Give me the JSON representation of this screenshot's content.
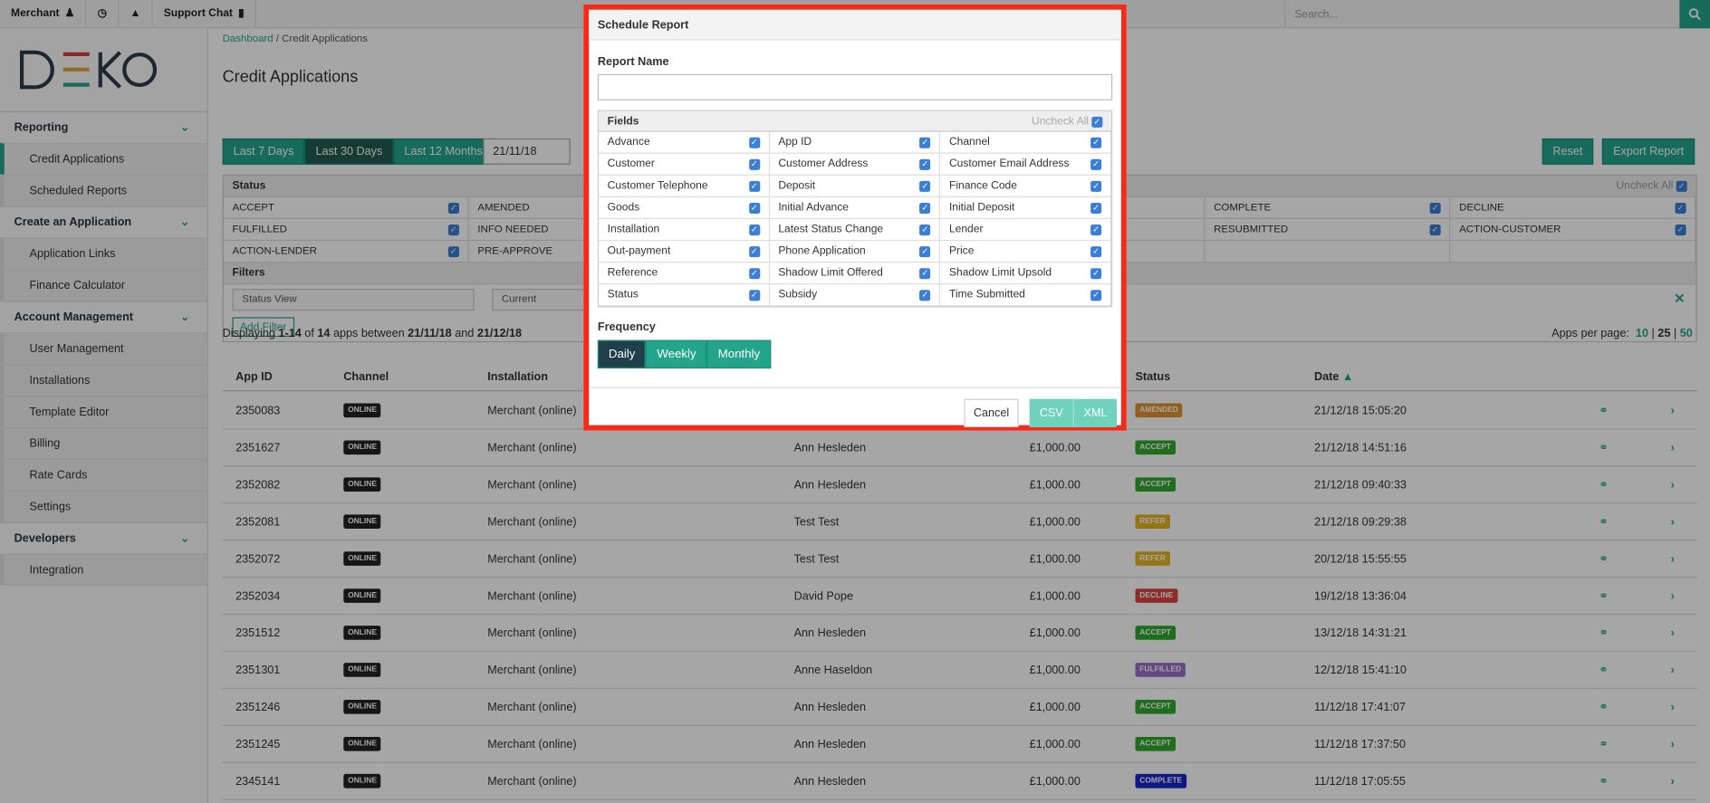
{
  "topbar": {
    "merchant": "Merchant",
    "support": "Support Chat",
    "search_placeholder": "Search..."
  },
  "logo": "D≡KO",
  "sidebar": {
    "sections": [
      {
        "label": "Reporting",
        "items": [
          "Credit Applications",
          "Scheduled Reports"
        ]
      },
      {
        "label": "Create an Application",
        "items": [
          "Application Links",
          "Finance Calculator"
        ]
      },
      {
        "label": "Account Management",
        "items": [
          "User Management",
          "Installations",
          "Template Editor",
          "Billing",
          "Rate Cards",
          "Settings"
        ]
      },
      {
        "label": "Developers",
        "items": [
          "Integration"
        ]
      }
    ]
  },
  "breadcrumb": {
    "home": "Dashboard",
    "sep": "/",
    "current": "Credit Applications"
  },
  "page_title": "Credit Applications",
  "range": {
    "b1": "Last 7 Days",
    "b2": "Last 30 Days",
    "b3": "Last 12 Months",
    "date": "21/11/18"
  },
  "actions": {
    "reset": "Reset",
    "export": "Export Report"
  },
  "status_box": {
    "title": "Status",
    "uncheck": "Uncheck All",
    "cells": [
      "ACCEPT",
      "AMENDED",
      "",
      "",
      "COMPLETE",
      "DECLINE",
      "FULFILLED",
      "INFO NEEDED",
      "",
      "",
      "RESUBMITTED",
      "ACTION-CUSTOMER",
      "ACTION-LENDER",
      "PRE-APPROVE",
      "",
      "",
      "",
      ""
    ],
    "filters": "Filters",
    "status_view": "Status View",
    "current": "Current",
    "add_filter": "Add Filter"
  },
  "display": {
    "a": "Displaying ",
    "b": "1-14",
    "c": " of ",
    "d": "14",
    "e": " apps between ",
    "f": "21/11/18",
    "g": " and ",
    "h": "21/12/18"
  },
  "per_page": {
    "label": "Apps per page:",
    "o1": "10",
    "o2": "25",
    "o3": "50"
  },
  "table": {
    "headers": {
      "app": "App ID",
      "channel": "Channel",
      "install": "Installation",
      "status": "Status",
      "date": "Date"
    },
    "rows": [
      {
        "id": "2350083",
        "ch": "ONLINE",
        "inst": "Merchant (online)",
        "cust": "",
        "amt": "",
        "st": "AMENDED",
        "date": "21/12/18 15:05:20"
      },
      {
        "id": "2351627",
        "ch": "ONLINE",
        "inst": "Merchant (online)",
        "cust": "Ann Hesleden",
        "amt": "£1,000.00",
        "st": "ACCEPT",
        "date": "21/12/18 14:51:16"
      },
      {
        "id": "2352082",
        "ch": "ONLINE",
        "inst": "Merchant (online)",
        "cust": "Ann Hesleden",
        "amt": "£1,000.00",
        "st": "ACCEPT",
        "date": "21/12/18 09:40:33"
      },
      {
        "id": "2352081",
        "ch": "ONLINE",
        "inst": "Merchant (online)",
        "cust": "Test Test",
        "amt": "£1,000.00",
        "st": "REFER",
        "date": "21/12/18 09:29:38"
      },
      {
        "id": "2352072",
        "ch": "ONLINE",
        "inst": "Merchant (online)",
        "cust": "Test Test",
        "amt": "£1,000.00",
        "st": "REFER",
        "date": "20/12/18 15:55:55"
      },
      {
        "id": "2352034",
        "ch": "ONLINE",
        "inst": "Merchant (online)",
        "cust": "David Pope",
        "amt": "£1,000.00",
        "st": "DECLINE",
        "date": "19/12/18 13:36:04"
      },
      {
        "id": "2351512",
        "ch": "ONLINE",
        "inst": "Merchant (online)",
        "cust": "Ann Hesleden",
        "amt": "£1,000.00",
        "st": "ACCEPT",
        "date": "13/12/18 14:31:21"
      },
      {
        "id": "2351301",
        "ch": "ONLINE",
        "inst": "Merchant (online)",
        "cust": "Anne Haseldon",
        "amt": "£1,000.00",
        "st": "FULFILLED",
        "date": "12/12/18 15:41:10"
      },
      {
        "id": "2351246",
        "ch": "ONLINE",
        "inst": "Merchant (online)",
        "cust": "Ann Hesleden",
        "amt": "£1,000.00",
        "st": "ACCEPT",
        "date": "11/12/18 17:41:07"
      },
      {
        "id": "2351245",
        "ch": "ONLINE",
        "inst": "Merchant (online)",
        "cust": "Ann Hesleden",
        "amt": "£1,000.00",
        "st": "ACCEPT",
        "date": "11/12/18 17:37:50"
      },
      {
        "id": "2345141",
        "ch": "ONLINE",
        "inst": "Merchant (online)",
        "cust": "Ann Hesleden",
        "amt": "£1,000.00",
        "st": "COMPLETE",
        "date": "11/12/18 17:05:55"
      }
    ]
  },
  "status_colors": {
    "AMENDED": "#e0932f",
    "ACCEPT": "#2eaa2e",
    "REFER": "#e3b520",
    "DECLINE": "#d9473f",
    "FULFILLED": "#9b6fc9",
    "COMPLETE": "#1a26c9"
  },
  "modal": {
    "title": "Schedule Report",
    "report_name_label": "Report Name",
    "report_name_value": "",
    "fields_label": "Fields",
    "uncheck_all": "Uncheck All",
    "fields": [
      "Advance",
      "App ID",
      "Channel",
      "Customer",
      "Customer Address",
      "Customer Email Address",
      "Customer Telephone",
      "Deposit",
      "Finance Code",
      "Goods",
      "Initial Advance",
      "Initial Deposit",
      "Installation",
      "Latest Status Change",
      "Lender",
      "Out-payment",
      "Phone Application",
      "Price",
      "Reference",
      "Shadow Limit Offered",
      "Shadow Limit Upsold",
      "Status",
      "Subsidy",
      "Time Submitted"
    ],
    "frequency_label": "Frequency",
    "freq": {
      "daily": "Daily",
      "weekly": "Weekly",
      "monthly": "Monthly",
      "selected": "Daily"
    },
    "cancel": "Cancel",
    "csv": "CSV",
    "xml": "XML"
  },
  "colors": {
    "accent": "#22a58a",
    "modal_border": "#f22b1b"
  }
}
